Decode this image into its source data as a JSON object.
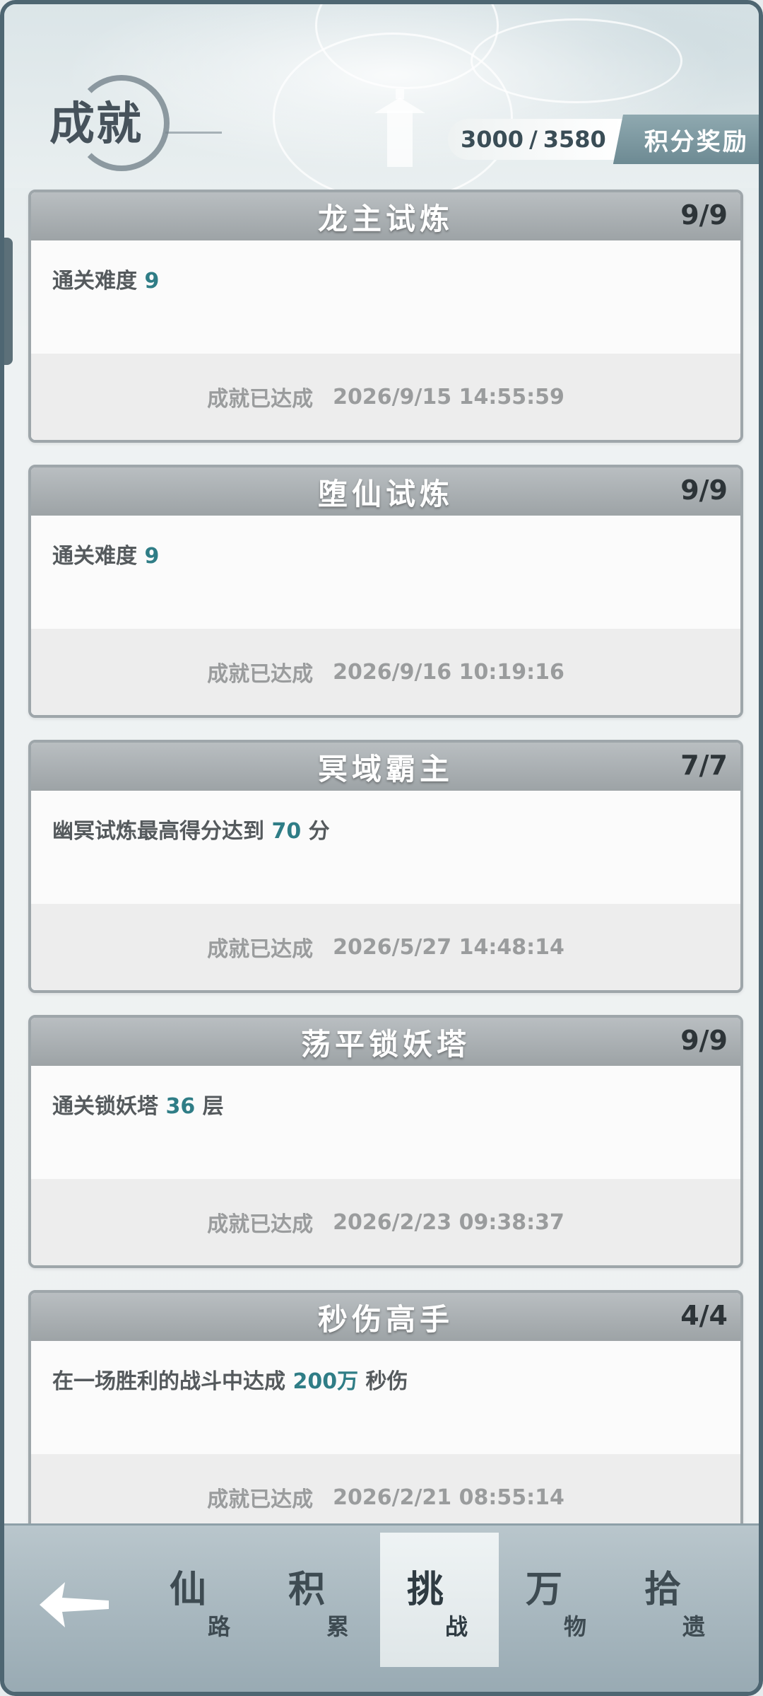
{
  "header": {
    "title": "成就",
    "score_current": "3000",
    "score_separator": "/",
    "score_total": "3580",
    "reward_button": "积分奖励"
  },
  "achievements": [
    {
      "title": "龙主试炼",
      "count": "9/9",
      "desc_prefix": "通关难度 ",
      "desc_value": "9",
      "desc_suffix": "",
      "status": "成就已达成",
      "time": "2026/9/15 14:55:59"
    },
    {
      "title": "堕仙试炼",
      "count": "9/9",
      "desc_prefix": "通关难度 ",
      "desc_value": "9",
      "desc_suffix": "",
      "status": "成就已达成",
      "time": "2026/9/16 10:19:16"
    },
    {
      "title": "冥域霸主",
      "count": "7/7",
      "desc_prefix": "幽冥试炼最高得分达到 ",
      "desc_value": "70",
      "desc_suffix": " 分",
      "status": "成就已达成",
      "time": "2026/5/27 14:48:14"
    },
    {
      "title": "荡平锁妖塔",
      "count": "9/9",
      "desc_prefix": "通关锁妖塔 ",
      "desc_value": "36",
      "desc_suffix": " 层",
      "status": "成就已达成",
      "time": "2026/2/23 09:38:37"
    },
    {
      "title": "秒伤高手",
      "count": "4/4",
      "desc_prefix": "在一场胜利的战斗中达成 ",
      "desc_value": "200万",
      "desc_suffix": " 秒伤",
      "status": "成就已达成",
      "time": "2026/2/21 08:55:14"
    }
  ],
  "nav": {
    "tabs": [
      {
        "big": "仙",
        "small": "路",
        "active": false
      },
      {
        "big": "积",
        "small": "累",
        "active": false
      },
      {
        "big": "挑",
        "small": "战",
        "active": true
      },
      {
        "big": "万",
        "small": "物",
        "active": false
      },
      {
        "big": "拾",
        "small": "遗",
        "active": false
      }
    ]
  },
  "colors": {
    "accent": "#2f7d86",
    "card_header": "#a3a9ac",
    "nav_bg": "#a8b8bf"
  },
  "icons": {
    "back": "back-arrow-icon"
  }
}
